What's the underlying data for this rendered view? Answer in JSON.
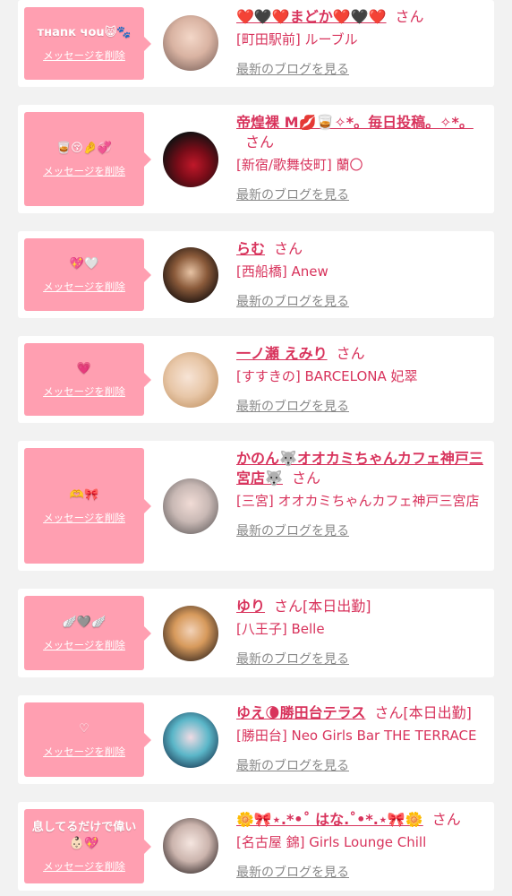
{
  "delete_label": "メッセージを削除",
  "san_label": "さん",
  "blog_label": "最新のブログを見る",
  "colors": {
    "accent": "#d8335c",
    "bubble": "#ff9fb1",
    "link": "#888888"
  },
  "cards": [
    {
      "message": "тнаnк чоu😸🐾",
      "name": "❤️🖤❤️まどか❤️🖤❤️",
      "status": "",
      "shop": "[町田駅前] ルーブル"
    },
    {
      "message": "🥃😚🤌💞",
      "name": "帝煌裸 M💋🥃✧*。毎日投稿。✧*。",
      "status": "",
      "shop": "[新宿/歌舞伎町] 蘭〇"
    },
    {
      "message": "💖🤍",
      "name": "らむ",
      "status": "",
      "shop": "[西船橋] Anew"
    },
    {
      "message": "💗",
      "name": "一ノ瀬 えみり",
      "status": "",
      "shop": "[すすきの] BARCELONA 妃翠"
    },
    {
      "message": "🫶🎀",
      "name": "かのん🐺オオカミちゃんカフェ神戸三宮店🐺",
      "status": "",
      "shop": "[三宮] オオカミちゃんカフェ神戸三宮店"
    },
    {
      "message": "🪽🩶🪽",
      "name": "ゆり",
      "status": "[本日出勤]",
      "shop": "[八王子] Belle"
    },
    {
      "message": "♡",
      "name": "ゆえ🌘勝田台テラス",
      "status": "[本日出勤]",
      "shop": "[勝田台] Neo Girls Bar THE TERRACE"
    },
    {
      "message": "息してるだけで偉い👶🏻💖",
      "name": "🌼🎀⋆.*•˚ はな.˚•*.⋆🎀🌼",
      "status": "",
      "shop": "[名古屋 錦] Girls Lounge Chill"
    }
  ]
}
